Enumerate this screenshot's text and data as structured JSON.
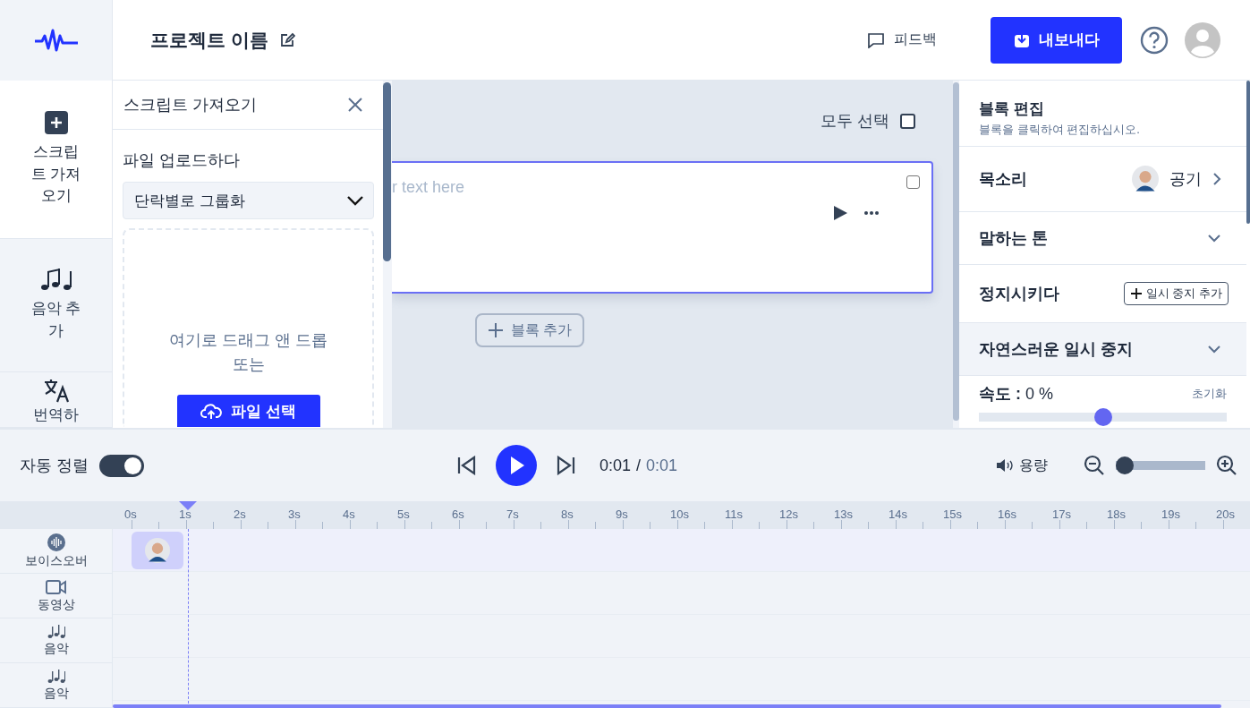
{
  "header": {
    "project_name": "프로젝트 이름",
    "feedback": "피드백",
    "export": "내보내다"
  },
  "sidebar": {
    "items": [
      {
        "kind": "plus",
        "label": "스크립트 가져오기",
        "selected": true
      },
      {
        "kind": "music",
        "label": "음악 추가",
        "selected": false
      },
      {
        "kind": "translate",
        "label": "번역하",
        "selected": false
      }
    ]
  },
  "import_panel": {
    "title": "스크립트 가져오기",
    "upload_label": "파일 업로드하다",
    "grouping": "단락별로 그룹화",
    "drop_text": "여기로 드래그 앤 드롭 또는",
    "choose_file": "파일 선택"
  },
  "canvas": {
    "select_all": {
      "label": "모두 선택",
      "checked": false
    },
    "blocks": [
      {
        "placeholder": "r text here",
        "checked": false
      }
    ],
    "add_block": "블록 추가"
  },
  "edit_panel": {
    "title": "블록 편집",
    "subtitle": "블록을 클릭하여 편집하십시오.",
    "rows": [
      {
        "kind": "voice",
        "label": "목소리",
        "value": "공기"
      },
      {
        "kind": "dropdown",
        "label": "말하는 톤",
        "highlighted": false
      },
      {
        "kind": "pause",
        "label": "정지시키다",
        "button": "일시 중지 추가"
      },
      {
        "kind": "dropdown",
        "label": "자연스러운 일시 중지",
        "highlighted": true
      },
      {
        "kind": "slider",
        "label": "**속도 :** 0 %",
        "reset": "초기화",
        "level": 0.5
      }
    ]
  },
  "player": {
    "auto_sort": {
      "label": "자동 정렬",
      "on": true
    },
    "current_time": "0:01",
    "separator": "/",
    "total_time": "0:01",
    "volume": "용량",
    "zoom": {
      "level": 0
    }
  },
  "timeline": {
    "ticks": [
      {
        "label": "0s",
        "current": false
      },
      {
        "label": "1s",
        "current": true
      },
      {
        "label": "2s",
        "current": false
      },
      {
        "label": "3s",
        "current": false
      },
      {
        "label": "4s",
        "current": false
      },
      {
        "label": "5s",
        "current": false
      },
      {
        "label": "6s",
        "current": false
      },
      {
        "label": "7s",
        "current": false
      },
      {
        "label": "8s",
        "current": false
      },
      {
        "label": "9s",
        "current": false
      },
      {
        "label": "10s",
        "current": false
      },
      {
        "label": "11s",
        "current": false
      },
      {
        "label": "12s",
        "current": false
      },
      {
        "label": "13s",
        "current": false
      },
      {
        "label": "14s",
        "current": false
      },
      {
        "label": "15s",
        "current": false
      },
      {
        "label": "16s",
        "current": false
      },
      {
        "label": "17s",
        "current": false
      },
      {
        "label": "18s",
        "current": false
      },
      {
        "label": "19s",
        "current": false
      },
      {
        "label": "20s",
        "current": false
      }
    ],
    "tracks": [
      {
        "kind": "voiceover",
        "label": "보이스오버",
        "has_clip": true
      },
      {
        "kind": "video",
        "label": "동영상",
        "has_clip": false
      },
      {
        "kind": "music",
        "label": "음악",
        "has_clip": false
      },
      {
        "kind": "music",
        "label": "음악",
        "has_clip": false
      }
    ]
  }
}
